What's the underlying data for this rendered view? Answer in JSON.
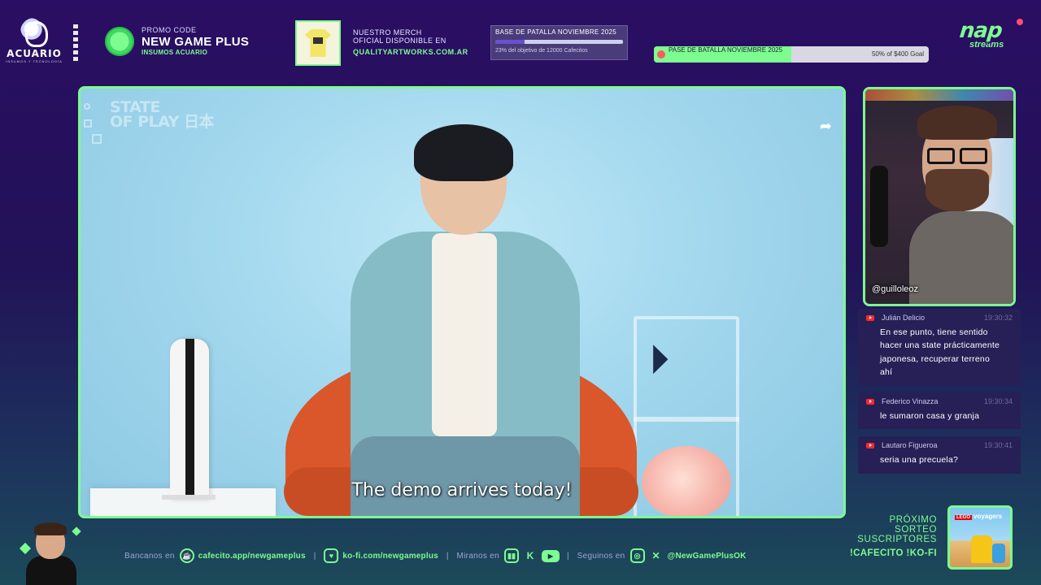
{
  "header": {
    "sponsor": {
      "name": "ACUARIO",
      "tagline": "INSUMOS Y TECNOLOGÍA"
    },
    "promo": {
      "label": "PROMO CODE",
      "code": "NEW GAME PLUS",
      "sponsor": "INSUMOS ACUARIO"
    },
    "merch": {
      "line1": "NUESTRO MERCH",
      "line2": "OFICIAL DISPONIBLE EN",
      "url": "QUALITYARTWORKS.COM.AR"
    },
    "goal_cafecito": {
      "title": "BASE DE PATALLA NOVIEMBRE 2025",
      "status": "23% del objetivo de 12000 Cafecitos",
      "progress": 0.23
    },
    "goal_kofi": {
      "title": "PASE DE BATALLA NOVIEMBRE 2025",
      "status": "50% of $400 Goal",
      "progress": 0.5
    },
    "brand": {
      "name": "nap",
      "sub": "streams"
    }
  },
  "video": {
    "watermark_line1": "STATE",
    "watermark_line2": "OF PLAY 日本",
    "subtitle": "The demo arrives today!",
    "share_icon": "share-icon"
  },
  "webcam": {
    "handle": "@guilloleoz"
  },
  "chat": {
    "messages": [
      {
        "author": "Julián Delicio",
        "time": "19:30:32",
        "text": "En ese punto, tiene sentido hacer una state prácticamente japonesa, recuperar terreno ahí"
      },
      {
        "author": "Federico Vinazza",
        "time": "19:30:34",
        "text": "le sumaron casa y granja"
      },
      {
        "author": "Lautaro Figueroa",
        "time": "19:30:41",
        "text": "seria una precuela?"
      }
    ]
  },
  "footer": {
    "bancanos_label": "Bancanos en",
    "cafecito": "cafecito.app/newgameplus",
    "kofi": "ko-fi.com/newgameplus",
    "miranos_label": "Miranos en",
    "seguinos_label": "Seguinos en",
    "handle": "@NewGamePlusOK",
    "sep": "|"
  },
  "sorteo": {
    "line1": "PRÓXIMO",
    "line2": "SORTEO",
    "line3": "SUSCRIPTORES",
    "commands": "!CAFECITO  !KO-FI",
    "prize_brand": "voyagers",
    "prize_maker": "LEGO"
  },
  "colors": {
    "accent": "#7dfc8f",
    "bg_top": "#2a0e63",
    "bg_bottom": "#1c4a5a",
    "chat_bg": "#262056"
  }
}
